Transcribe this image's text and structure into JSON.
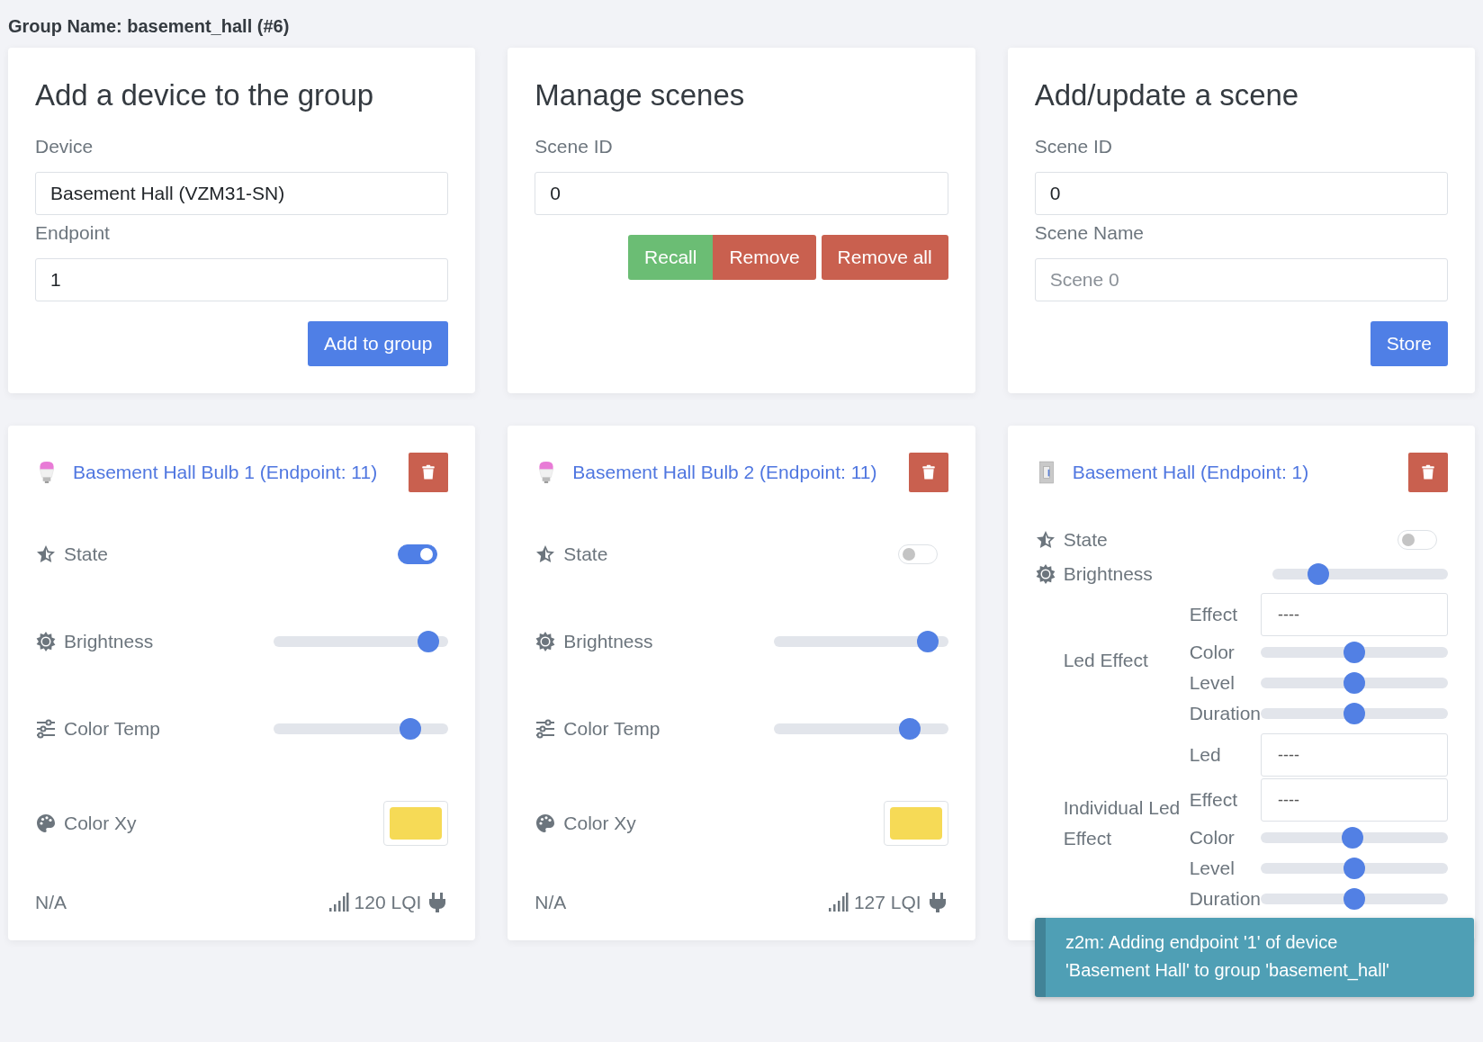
{
  "group_title": "Group Name: basement_hall (#6)",
  "add_device": {
    "title": "Add a device to the group",
    "device_label": "Device",
    "device_value": "Basement Hall (VZM31-SN)",
    "endpoint_label": "Endpoint",
    "endpoint_value": "1",
    "button": "Add to group"
  },
  "manage_scenes": {
    "title": "Manage scenes",
    "scene_id_label": "Scene ID",
    "scene_id_value": "0",
    "button_groups": [
      [
        {
          "label": "Recall",
          "kind": "success"
        },
        {
          "label": "Remove",
          "kind": "danger"
        }
      ],
      [
        {
          "label": "Remove all",
          "kind": "danger"
        }
      ]
    ]
  },
  "add_scene": {
    "title": "Add/update a scene",
    "scene_id_label": "Scene ID",
    "scene_id_value": "0",
    "scene_name_label": "Scene Name",
    "scene_name_placeholder": "Scene 0",
    "button": "Store"
  },
  "devices": [
    {
      "kind": "bulb",
      "name": "Basement Hall Bulb 1 (Endpoint: 11)",
      "features": [
        {
          "kind": "state",
          "label": "State",
          "on": true
        },
        {
          "kind": "brightness",
          "label": "Brightness",
          "level": 0.94
        },
        {
          "kind": "colortemp",
          "label": "Color Temp",
          "level": 0.82
        },
        {
          "kind": "colorxy",
          "label": "Color Xy",
          "color": "#f6da56"
        }
      ],
      "footer": {
        "status": "N/A",
        "lqi": "120 LQI"
      }
    },
    {
      "kind": "bulb",
      "name": "Basement Hall Bulb 2 (Endpoint: 11)",
      "features": [
        {
          "kind": "state",
          "label": "State",
          "on": false
        },
        {
          "kind": "brightness",
          "label": "Brightness",
          "level": 0.94
        },
        {
          "kind": "colortemp",
          "label": "Color Temp",
          "level": 0.82
        },
        {
          "kind": "colorxy",
          "label": "Color Xy",
          "color": "#f6da56"
        }
      ],
      "footer": {
        "status": "N/A",
        "lqi": "127 LQI"
      }
    },
    {
      "kind": "switch",
      "name": "Basement Hall (Endpoint: 1)",
      "features": [
        {
          "kind": "state",
          "label": "State",
          "on": false
        },
        {
          "kind": "brightness",
          "label": "Brightness",
          "level": 0.23
        },
        {
          "kind": "composite",
          "label": "Led Effect",
          "items": [
            {
              "kind": "select",
              "label": "Effect",
              "value": "----"
            },
            {
              "kind": "slider",
              "label": "Color",
              "level": 0.5
            },
            {
              "kind": "slider",
              "label": "Level",
              "level": 0.5
            },
            {
              "kind": "slider",
              "label": "Duration",
              "level": 0.5
            }
          ]
        },
        {
          "kind": "composite",
          "label": "Individual Led Effect",
          "items": [
            {
              "kind": "select",
              "label": "Led",
              "value": "----"
            },
            {
              "kind": "select",
              "label": "Effect",
              "value": "----"
            },
            {
              "kind": "slider",
              "label": "Color",
              "level": 0.49
            },
            {
              "kind": "slider",
              "label": "Level",
              "level": 0.5
            },
            {
              "kind": "slider",
              "label": "Duration",
              "level": 0.5
            }
          ]
        }
      ]
    }
  ],
  "toast": {
    "text": "z2m: Adding endpoint '1' of device 'Basement Hall' to group 'basement_hall'"
  }
}
